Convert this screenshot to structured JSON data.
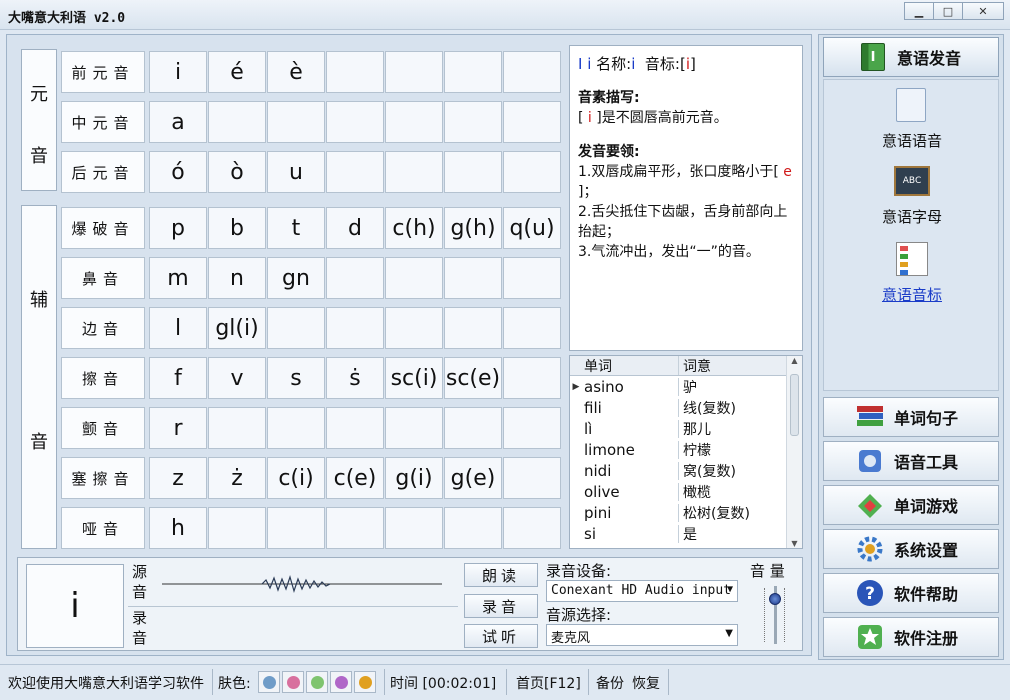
{
  "window": {
    "title": "大嘴意大利语 v2.0",
    "min": "▁",
    "max": "□",
    "close": "✕"
  },
  "vowels": {
    "group_label_1": "元",
    "group_label_2": "音",
    "rows": [
      {
        "label": "前元音",
        "cells": [
          "i",
          "é",
          "è",
          "",
          "",
          "",
          ""
        ]
      },
      {
        "label": "中元音",
        "cells": [
          "a",
          "",
          "",
          "",
          "",
          "",
          ""
        ]
      },
      {
        "label": "后元音",
        "cells": [
          "ó",
          "ò",
          "u",
          "",
          "",
          "",
          ""
        ]
      }
    ]
  },
  "consonants": {
    "group_label_1": "辅",
    "group_label_2": "音",
    "rows": [
      {
        "label": "爆破音",
        "cells": [
          "p",
          "b",
          "t",
          "d",
          "c(h)",
          "g(h)",
          "q(u)"
        ]
      },
      {
        "label": "鼻音",
        "cells": [
          "m",
          "n",
          "gn",
          "",
          "",
          "",
          ""
        ]
      },
      {
        "label": "边音",
        "cells": [
          "l",
          "gl(i)",
          "",
          "",
          "",
          "",
          ""
        ]
      },
      {
        "label": "擦音",
        "cells": [
          "f",
          "v",
          "s",
          "ṡ",
          "sc(i)",
          "sc(e)",
          ""
        ]
      },
      {
        "label": "颤音",
        "cells": [
          "r",
          "",
          "",
          "",
          "",
          "",
          ""
        ]
      },
      {
        "label": "塞擦音",
        "cells": [
          "z",
          "ż",
          "c(i)",
          "c(e)",
          "g(i)",
          "g(e)",
          ""
        ]
      },
      {
        "label": "哑音",
        "cells": [
          "h",
          "",
          "",
          "",
          "",
          "",
          ""
        ]
      }
    ]
  },
  "info": {
    "letter": "I i",
    "name_label": "名称:",
    "name_value": "i",
    "phonetic_label": "音标:",
    "phonetic_open": "[",
    "phonetic_value": "i",
    "phonetic_close": "]",
    "desc_title": "音素描写:",
    "desc_symbol": "i",
    "desc_text": "是不圆唇高前元音。",
    "tips_title": "发音要领:",
    "tip1a": "1.双唇成扁平形，张口度略小于",
    "tip1_symbol": "e",
    "tip1b": "；",
    "tip2": "2.舌尖抵住下齿龈，舌身前部向上抬起；",
    "tip3": "3.气流冲出，发出“一”的音。"
  },
  "wordlist": {
    "col_word": "单词",
    "col_meaning": "词意",
    "rows": [
      {
        "word": "asino",
        "meaning": "驴"
      },
      {
        "word": "fili",
        "meaning": "线(复数)"
      },
      {
        "word": "lì",
        "meaning": "那儿"
      },
      {
        "word": "limone",
        "meaning": "柠檬"
      },
      {
        "word": "nidi",
        "meaning": "窝(复数)"
      },
      {
        "word": "olive",
        "meaning": "橄榄"
      },
      {
        "word": "pini",
        "meaning": "松树(复数)"
      },
      {
        "word": "si",
        "meaning": "是"
      }
    ]
  },
  "player": {
    "big_letter": "i",
    "source_label": "源音",
    "record_label": "录音",
    "read_button": "朗读",
    "record_button": "录音",
    "listen_button": "试听",
    "device_label": "录音设备:",
    "device_value": "Conexant HD Audio input",
    "source_select_label": "音源选择:",
    "source_select_value": "麦克风",
    "volume_label": "音 量",
    "volume_level": 0.85
  },
  "sidebar": {
    "top": "意语发音",
    "sub": [
      "意语语音",
      "意语字母",
      "意语音标"
    ],
    "buttons": [
      "单词句子",
      "语音工具",
      "单词游戏",
      "系统设置",
      "软件帮助",
      "软件注册"
    ]
  },
  "status": {
    "welcome": "欢迎使用大嘴意大利语学习软件",
    "skin_label": "肤色:",
    "skin_colors": [
      "#6f9cc8",
      "#d8709e",
      "#7fc46f",
      "#b067c8",
      "#e0a020"
    ],
    "time": "时间 [00:02:01]",
    "home": "首页[F12]",
    "backup": "备份",
    "restore": "恢复"
  }
}
